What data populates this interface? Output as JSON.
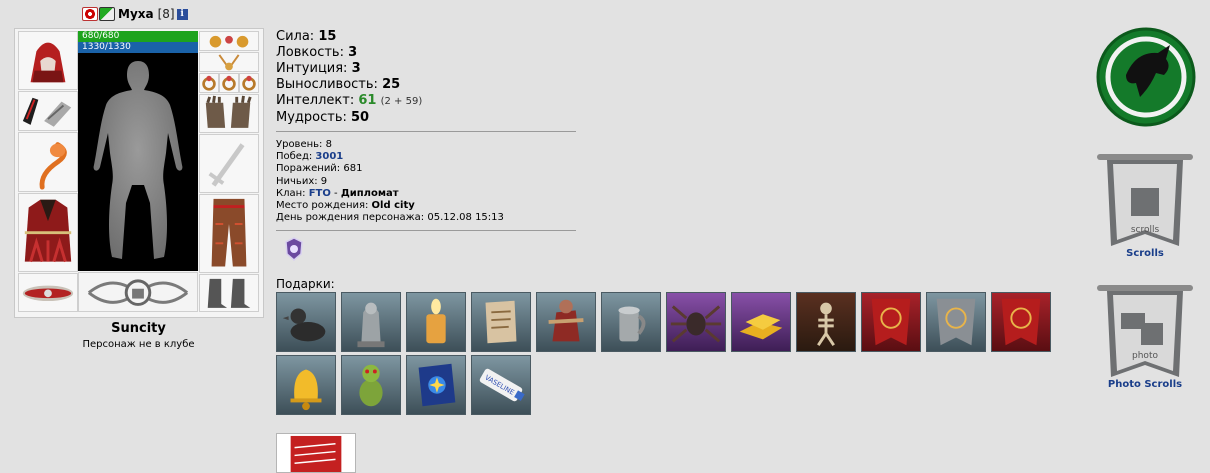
{
  "character": {
    "name": "Муха",
    "level": "[8]",
    "hp": "680/680",
    "mp": "1330/1330",
    "city": "Suncity",
    "club_status": "Персонаж не в клубе"
  },
  "stats": [
    {
      "label": "Сила: ",
      "value": "15"
    },
    {
      "label": "Ловкость: ",
      "value": "3"
    },
    {
      "label": "Интуиция: ",
      "value": "3"
    },
    {
      "label": "Выносливость: ",
      "value": "25"
    },
    {
      "label": "Интеллект: ",
      "value": "61",
      "extra": "(2 + 59)"
    },
    {
      "label": "Мудрость: ",
      "value": "50"
    }
  ],
  "info": {
    "level": {
      "label": "Уровень: ",
      "value": "8"
    },
    "wins": {
      "label": "Побед: ",
      "value": "3001"
    },
    "losses": {
      "label": "Поражений: ",
      "value": "681"
    },
    "draws": {
      "label": "Ничьих: ",
      "value": "9"
    },
    "clan": {
      "label": "Клан: ",
      "name": "FTO",
      "sep": " - ",
      "role": "Дипломат"
    },
    "birthplace": {
      "label": "Место рождения: ",
      "value": "Old city"
    },
    "birthday": {
      "label": "День рождения персонажа: ",
      "value": "05.12.08 15:13"
    }
  },
  "gifts": {
    "label": "Подарки:",
    "items": [
      {
        "icon": "rubber-duck-icon"
      },
      {
        "icon": "statue-icon"
      },
      {
        "icon": "candle-icon"
      },
      {
        "icon": "scroll-icon"
      },
      {
        "icon": "warrior-icon"
      },
      {
        "icon": "tankard-icon"
      },
      {
        "icon": "spider-icon"
      },
      {
        "icon": "gold-bars-icon"
      },
      {
        "icon": "skeleton-icon"
      },
      {
        "icon": "red-banner-icon"
      },
      {
        "icon": "gray-banner-icon"
      },
      {
        "icon": "red-banner-icon"
      },
      {
        "icon": "bell-icon"
      },
      {
        "icon": "goblin-icon"
      },
      {
        "icon": "spellbook-icon"
      },
      {
        "icon": "vaseline-tube-icon",
        "text": "VASELINE"
      }
    ]
  },
  "right": {
    "scrolls_label": "Scrolls",
    "scrolls_inner": "scrolls",
    "photo_scrolls_label": "Photo Scrolls",
    "photo_inner": "photo"
  },
  "colors": {
    "background": "#e2e2e2",
    "hp": "#1da31d",
    "mp": "#1a62a8",
    "link": "#1a3e8a",
    "emblem": "#147a2a"
  }
}
